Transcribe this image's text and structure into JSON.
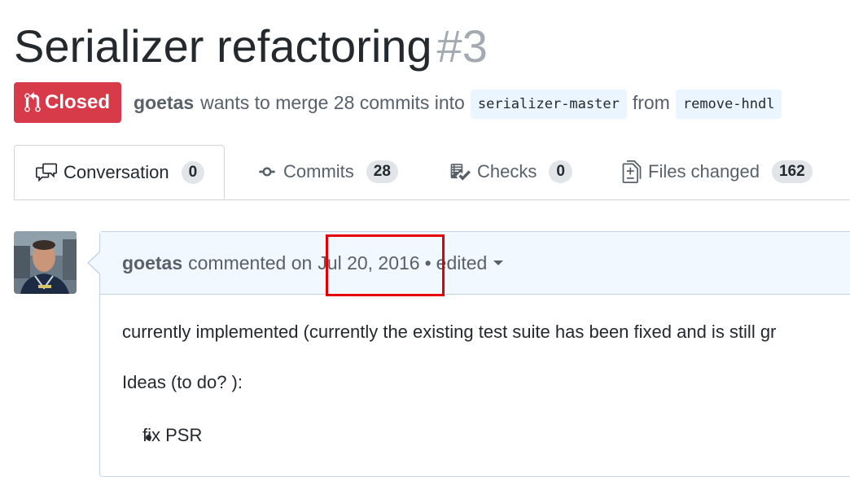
{
  "pr": {
    "title": "Serializer refactoring",
    "number": "#3",
    "state": "Closed",
    "author": "goetas",
    "merge_text": "wants to merge 28 commits into",
    "base_branch": "serializer-master",
    "from_text": "from",
    "head_branch": "remove-hndl"
  },
  "tabs": [
    {
      "label": "Conversation",
      "count": "0",
      "icon": "comment-discussion-icon",
      "selected": true
    },
    {
      "label": "Commits",
      "count": "28",
      "icon": "git-commit-icon",
      "selected": false
    },
    {
      "label": "Checks",
      "count": "0",
      "icon": "checklist-icon",
      "selected": false
    },
    {
      "label": "Files changed",
      "count": "162",
      "icon": "diff-icon",
      "selected": false
    }
  ],
  "comment": {
    "author": "goetas",
    "action": "commented on",
    "date": "Jul 20, 2016",
    "separator": "•",
    "edited": "edited",
    "paragraph1": "currently implemented (currently the existing test suite has been fixed and is still gr",
    "paragraph2": "Ideas (to do? ):",
    "list_items": [
      "fix PSR"
    ]
  },
  "colors": {
    "closed_badge": "#d73a49",
    "branch_bg": "#eaf5ff",
    "comment_header_bg": "#f1f8ff",
    "highlight": "#e30000"
  }
}
